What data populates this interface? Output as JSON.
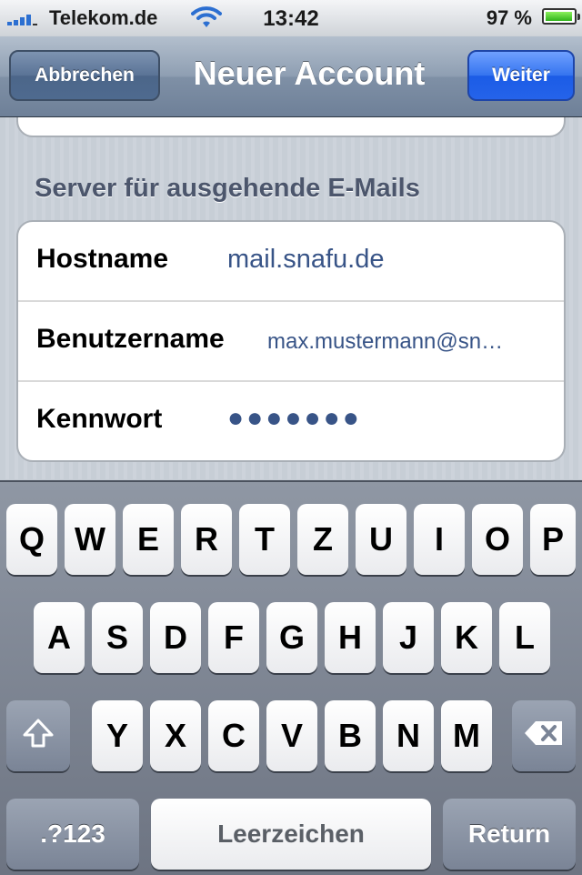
{
  "status_bar": {
    "carrier": "Telekom.de",
    "time": "13:42",
    "battery_percent": "97 %",
    "battery_level": 0.97,
    "signal_icon": "signal-bars-icon",
    "wifi_icon": "wifi-icon",
    "battery_icon": "battery-icon"
  },
  "navbar": {
    "cancel_label": "Abbrechen",
    "title": "Neuer Account",
    "next_label": "Weiter"
  },
  "form": {
    "section_header": "Server für ausgehende E-Mails",
    "rows": [
      {
        "label": "Hostname",
        "value": "mail.snafu.de"
      },
      {
        "label": "Benutzername",
        "value": "max.mustermann@sn…"
      },
      {
        "label": "Kennwort",
        "value": "●●●●●●●"
      }
    ]
  },
  "keyboard": {
    "row1": [
      "Q",
      "W",
      "E",
      "R",
      "T",
      "Z",
      "U",
      "I",
      "O",
      "P"
    ],
    "row2": [
      "A",
      "S",
      "D",
      "F",
      "G",
      "H",
      "J",
      "K",
      "L"
    ],
    "row3": [
      "Y",
      "X",
      "C",
      "V",
      "B",
      "N",
      "M"
    ],
    "shift_icon": "shift-icon",
    "backspace_icon": "backspace-icon",
    "numbers_label": ".?123",
    "space_label": "Leerzeichen",
    "return_label": "Return"
  },
  "colors": {
    "accent_blue": "#2563ea",
    "field_value": "#385487",
    "section_header": "#4c566c"
  }
}
